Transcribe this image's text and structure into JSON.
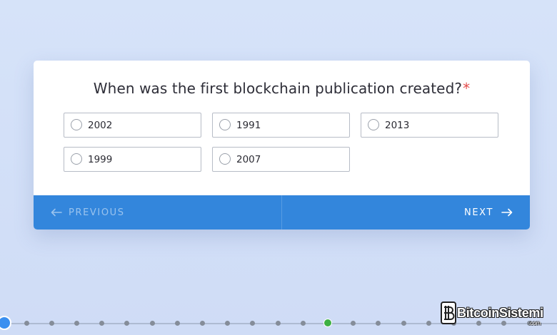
{
  "question": {
    "text": "When was the first blockchain publication created?",
    "required_mark": "*"
  },
  "options": [
    {
      "label": "2002",
      "selected": false
    },
    {
      "label": "1991",
      "selected": false
    },
    {
      "label": "2013",
      "selected": false
    },
    {
      "label": "1999",
      "selected": false
    },
    {
      "label": "2007",
      "selected": false
    }
  ],
  "navigation": {
    "previous_label": "PREVIOUS",
    "next_label": "NEXT",
    "previous_enabled": false
  },
  "progress": {
    "total_steps": 22,
    "current_step": 1,
    "marked_step": 14
  },
  "watermark": {
    "brand": "BitcoinSistemi",
    "suffix": ".com"
  },
  "colors": {
    "accent": "#3386dc",
    "required": "#e44b4b",
    "marked_step": "#3cb043",
    "current_step": "#3a8ff0"
  }
}
